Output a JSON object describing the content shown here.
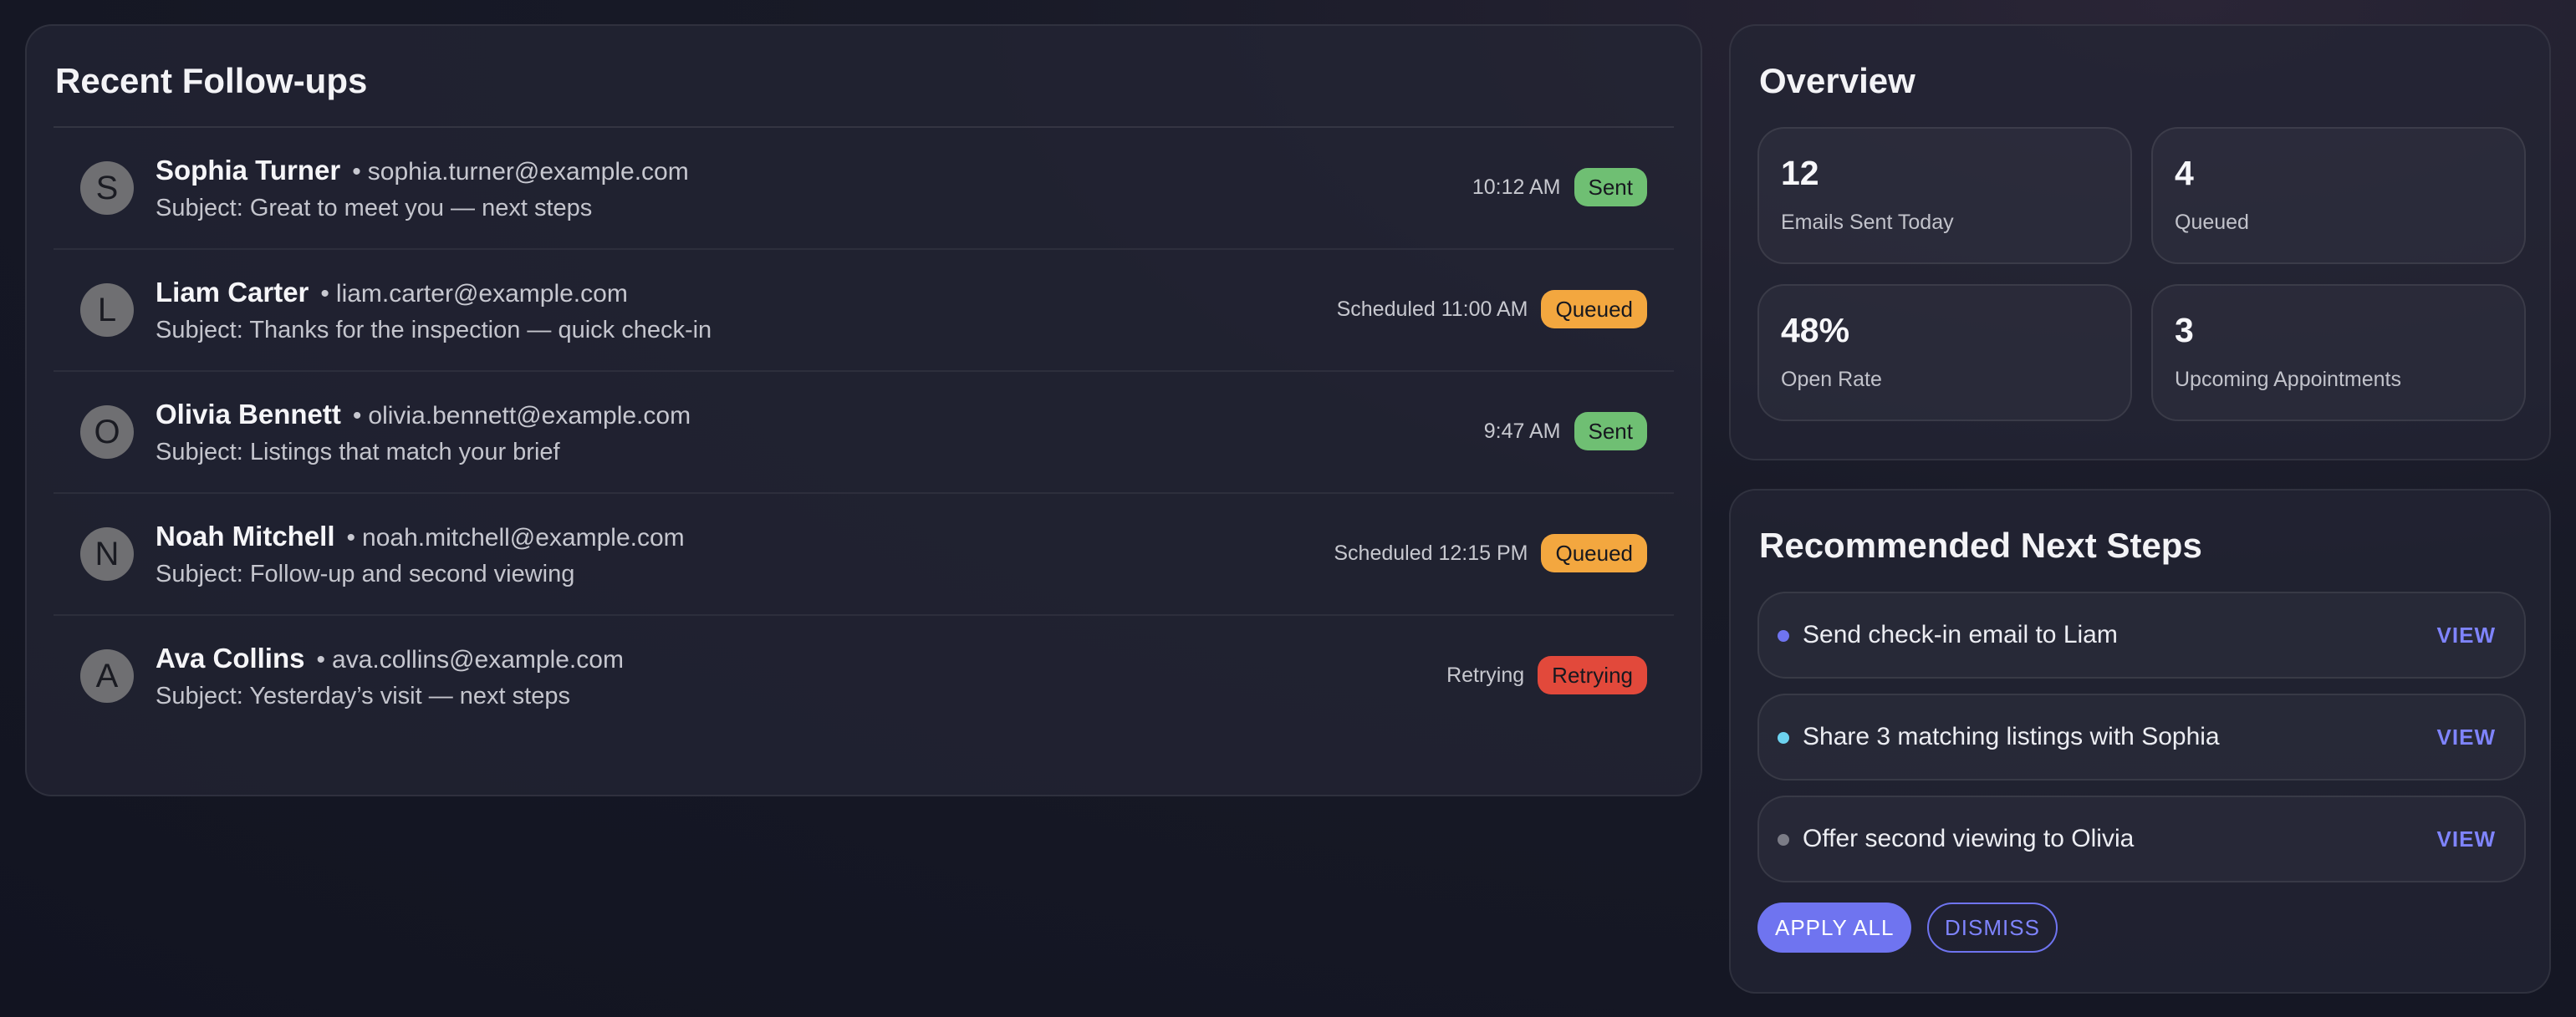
{
  "followups": {
    "title": "Recent Follow-ups",
    "items": [
      {
        "initial": "S",
        "name": "Sophia Turner",
        "email": "sophia.turner@example.com",
        "subject": "Subject: Great to meet you — next steps",
        "time": "10:12 AM",
        "status": "Sent",
        "status_color": "#6fbf73"
      },
      {
        "initial": "L",
        "name": "Liam Carter",
        "email": "liam.carter@example.com",
        "subject": "Subject: Thanks for the inspection — quick check-in",
        "time": "Scheduled 11:00 AM",
        "status": "Queued",
        "status_color": "#f3a73f"
      },
      {
        "initial": "O",
        "name": "Olivia Bennett",
        "email": "olivia.bennett@example.com",
        "subject": "Subject: Listings that match your brief",
        "time": "9:47 AM",
        "status": "Sent",
        "status_color": "#6fbf73"
      },
      {
        "initial": "N",
        "name": "Noah Mitchell",
        "email": "noah.mitchell@example.com",
        "subject": "Subject: Follow-up and second viewing",
        "time": "Scheduled 12:15 PM",
        "status": "Queued",
        "status_color": "#f3a73f"
      },
      {
        "initial": "A",
        "name": "Ava Collins",
        "email": "ava.collins@example.com",
        "subject": "Subject: Yesterday’s visit — next steps",
        "time": "Retrying",
        "status": "Retrying",
        "status_color": "#e2493b"
      }
    ]
  },
  "overview": {
    "title": "Overview",
    "stats": [
      {
        "value": "12",
        "label": "Emails Sent Today"
      },
      {
        "value": "4",
        "label": "Queued"
      },
      {
        "value": "48%",
        "label": "Open Rate"
      },
      {
        "value": "3",
        "label": "Upcoming Appointments"
      }
    ]
  },
  "next_steps": {
    "title": "Recommended Next Steps",
    "items": [
      {
        "text": "Send check-in email to Liam",
        "action": "VIEW",
        "dot_color": "#6f74f0"
      },
      {
        "text": "Share 3 matching listings with Sophia",
        "action": "VIEW",
        "dot_color": "#6dd3f0"
      },
      {
        "text": "Offer second viewing to Olivia",
        "action": "VIEW",
        "dot_color": "#7b7c86"
      }
    ],
    "apply_label": "APPLY ALL",
    "dismiss_label": "DISMISS"
  },
  "theme": {
    "accent": "#6f74f0",
    "accent_text": "#7f84ff"
  }
}
